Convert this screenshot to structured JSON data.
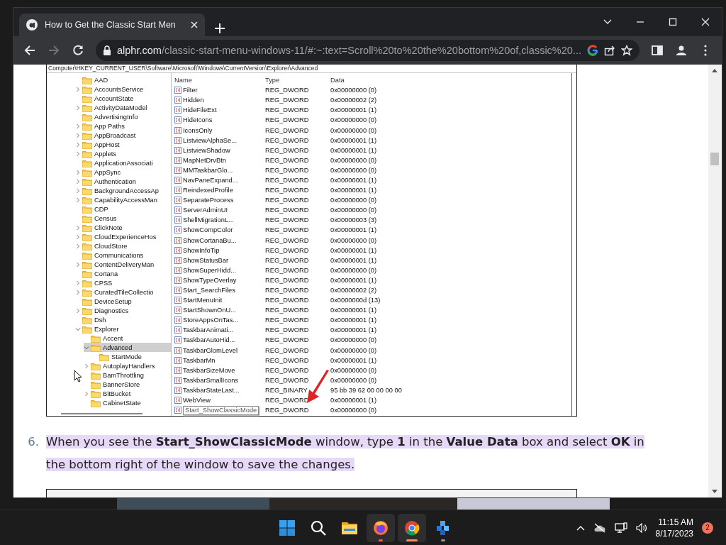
{
  "browser": {
    "tab": {
      "title": "How to Get the Classic Start Men",
      "selected": true
    },
    "address": {
      "host": "alphr.com",
      "path": "/classic-start-menu-windows-11/#:~:text=Scroll%20to%20the%20bottom%20of,classic%20..."
    },
    "forward_disabled": true
  },
  "registry_screenshot": {
    "path": "Computer\\HKEY_CURRENT_USER\\Software\\Microsoft\\Windows\\CurrentVersion\\Explorer\\Advanced",
    "tree": [
      {
        "label": "AAD",
        "selected": false
      },
      {
        "label": "AccountsService",
        "expanded": false,
        "selected": false
      },
      {
        "label": "AccountState",
        "selected": false
      },
      {
        "label": "ActivityDataModel",
        "expanded": false,
        "selected": false
      },
      {
        "label": "AdvertisingInfo",
        "selected": false
      },
      {
        "label": "App Paths",
        "expanded": false,
        "selected": false
      },
      {
        "label": "AppBroadcast",
        "expanded": false,
        "selected": false
      },
      {
        "label": "AppHost",
        "expanded": false,
        "selected": false
      },
      {
        "label": "Applets",
        "expanded": false,
        "selected": false
      },
      {
        "label": "ApplicationAssociati",
        "selected": false
      },
      {
        "label": "AppSync",
        "expanded": false,
        "selected": false
      },
      {
        "label": "Authentication",
        "expanded": false,
        "selected": false
      },
      {
        "label": "BackgroundAccessAp",
        "expanded": false,
        "selected": false
      },
      {
        "label": "CapabilityAccessMan",
        "expanded": false,
        "selected": false
      },
      {
        "label": "CDP",
        "selected": false
      },
      {
        "label": "Census",
        "selected": false
      },
      {
        "label": "ClickNote",
        "expanded": false,
        "selected": false
      },
      {
        "label": "CloudExperienceHos",
        "expanded": false,
        "selected": false
      },
      {
        "label": "CloudStore",
        "expanded": false,
        "selected": false
      },
      {
        "label": "Communications",
        "selected": false
      },
      {
        "label": "ContentDeliveryMan",
        "expanded": false,
        "selected": false
      },
      {
        "label": "Cortana",
        "selected": false
      },
      {
        "label": "CPSS",
        "expanded": false,
        "selected": false
      },
      {
        "label": "CuratedTileCollectio",
        "expanded": false,
        "selected": false
      },
      {
        "label": "DeviceSetup",
        "selected": false
      },
      {
        "label": "Diagnostics",
        "expanded": false,
        "selected": false
      },
      {
        "label": "Dsh",
        "selected": false
      },
      {
        "label": "Explorer",
        "expanded": true,
        "selected": false,
        "children": [
          {
            "label": "Accent",
            "selected": false
          },
          {
            "label": "Advanced",
            "expanded": true,
            "selected": true,
            "children": [
              {
                "label": "StartMode",
                "selected": false
              }
            ]
          },
          {
            "label": "AutoplayHandlers",
            "expanded": false,
            "selected": false
          },
          {
            "label": "BamThrottling",
            "selected": false
          },
          {
            "label": "BannerStore",
            "selected": false
          },
          {
            "label": "BitBucket",
            "expanded": false,
            "selected": false
          },
          {
            "label": "CabinetState",
            "selected": false
          }
        ]
      }
    ],
    "columns": [
      "Name",
      "Type",
      "Data"
    ],
    "values": [
      {
        "name": "Filter",
        "type": "REG_DWORD",
        "data": "0x00000000 (0)",
        "editing": false
      },
      {
        "name": "Hidden",
        "type": "REG_DWORD",
        "data": "0x00000002 (2)",
        "editing": false
      },
      {
        "name": "HideFileExt",
        "type": "REG_DWORD",
        "data": "0x00000001 (1)",
        "editing": false
      },
      {
        "name": "HideIcons",
        "type": "REG_DWORD",
        "data": "0x00000000 (0)",
        "editing": false
      },
      {
        "name": "IconsOnly",
        "type": "REG_DWORD",
        "data": "0x00000000 (0)",
        "editing": false
      },
      {
        "name": "ListviewAlphaSe...",
        "type": "REG_DWORD",
        "data": "0x00000001 (1)",
        "editing": false
      },
      {
        "name": "ListviewShadow",
        "type": "REG_DWORD",
        "data": "0x00000001 (1)",
        "editing": false
      },
      {
        "name": "MapNetDrvBtn",
        "type": "REG_DWORD",
        "data": "0x00000000 (0)",
        "editing": false
      },
      {
        "name": "MMTaskbarGlo...",
        "type": "REG_DWORD",
        "data": "0x00000000 (0)",
        "editing": false
      },
      {
        "name": "NavPaneExpand...",
        "type": "REG_DWORD",
        "data": "0x00000001 (1)",
        "editing": false
      },
      {
        "name": "ReindexedProfile",
        "type": "REG_DWORD",
        "data": "0x00000001 (1)",
        "editing": false
      },
      {
        "name": "SeparateProcess",
        "type": "REG_DWORD",
        "data": "0x00000000 (0)",
        "editing": false
      },
      {
        "name": "ServerAdminUI",
        "type": "REG_DWORD",
        "data": "0x00000000 (0)",
        "editing": false
      },
      {
        "name": "ShellMigrationL...",
        "type": "REG_DWORD",
        "data": "0x00000003 (3)",
        "editing": false
      },
      {
        "name": "ShowCompColor",
        "type": "REG_DWORD",
        "data": "0x00000001 (1)",
        "editing": false
      },
      {
        "name": "ShowCortanaBu...",
        "type": "REG_DWORD",
        "data": "0x00000000 (0)",
        "editing": false
      },
      {
        "name": "ShowInfoTip",
        "type": "REG_DWORD",
        "data": "0x00000001 (1)",
        "editing": false
      },
      {
        "name": "ShowStatusBar",
        "type": "REG_DWORD",
        "data": "0x00000001 (1)",
        "editing": false
      },
      {
        "name": "ShowSuperHidd...",
        "type": "REG_DWORD",
        "data": "0x00000000 (0)",
        "editing": false
      },
      {
        "name": "ShowTypeOverlay",
        "type": "REG_DWORD",
        "data": "0x00000001 (1)",
        "editing": false
      },
      {
        "name": "Start_SearchFiles",
        "type": "REG_DWORD",
        "data": "0x00000002 (2)",
        "editing": false
      },
      {
        "name": "StartMenuInit",
        "type": "REG_DWORD",
        "data": "0x0000000d (13)",
        "editing": false
      },
      {
        "name": "StartShownOnU...",
        "type": "REG_DWORD",
        "data": "0x00000001 (1)",
        "editing": false
      },
      {
        "name": "StoreAppsOnTas...",
        "type": "REG_DWORD",
        "data": "0x00000001 (1)",
        "editing": false
      },
      {
        "name": "TaskbarAnimati...",
        "type": "REG_DWORD",
        "data": "0x00000001 (1)",
        "editing": false
      },
      {
        "name": "TaskbarAutoHid...",
        "type": "REG_DWORD",
        "data": "0x00000000 (0)",
        "editing": false
      },
      {
        "name": "TaskbarGlomLevel",
        "type": "REG_DWORD",
        "data": "0x00000000 (0)",
        "editing": false
      },
      {
        "name": "TaskbarMn",
        "type": "REG_DWORD",
        "data": "0x00000001 (1)",
        "editing": false
      },
      {
        "name": "TaskbarSizeMove",
        "type": "REG_DWORD",
        "data": "0x00000000 (0)",
        "editing": false
      },
      {
        "name": "TaskbarSmallIcons",
        "type": "REG_DWORD",
        "data": "0x00000000 (0)",
        "editing": false
      },
      {
        "name": "TaskbarStateLast...",
        "type": "REG_BINARY",
        "data": "95 bb 39 62 00 00 00 00",
        "editing": false
      },
      {
        "name": "WebView",
        "type": "REG_DWORD",
        "data": "0x00000001 (1)",
        "editing": false
      },
      {
        "name": "Start_ShowClassicMode",
        "type": "REG_DWORD",
        "data": "0x00000000 (0)",
        "editing": true
      }
    ]
  },
  "step": {
    "number": "6.",
    "text": "When you see the **Start_ShowClassicMode** window, type **1** in the **Value Data** box and select **OK** in the bottom right of the window to save the changes.",
    "highlighted": true
  },
  "taskbar": {
    "apps": [
      {
        "kind": "start",
        "highlighted": false,
        "running": false,
        "active": false
      },
      {
        "kind": "search",
        "highlighted": false,
        "running": false,
        "active": false
      },
      {
        "kind": "files",
        "highlighted": false,
        "running": false,
        "active": false
      },
      {
        "kind": "firefox",
        "highlighted": true,
        "running": true,
        "active": false
      },
      {
        "kind": "chrome",
        "highlighted": true,
        "running": true,
        "active": true
      },
      {
        "kind": "cubes",
        "highlighted": false,
        "running": true,
        "active": false
      }
    ],
    "time": "11:15 AM",
    "date": "8/17/2023",
    "notifications": "2"
  }
}
